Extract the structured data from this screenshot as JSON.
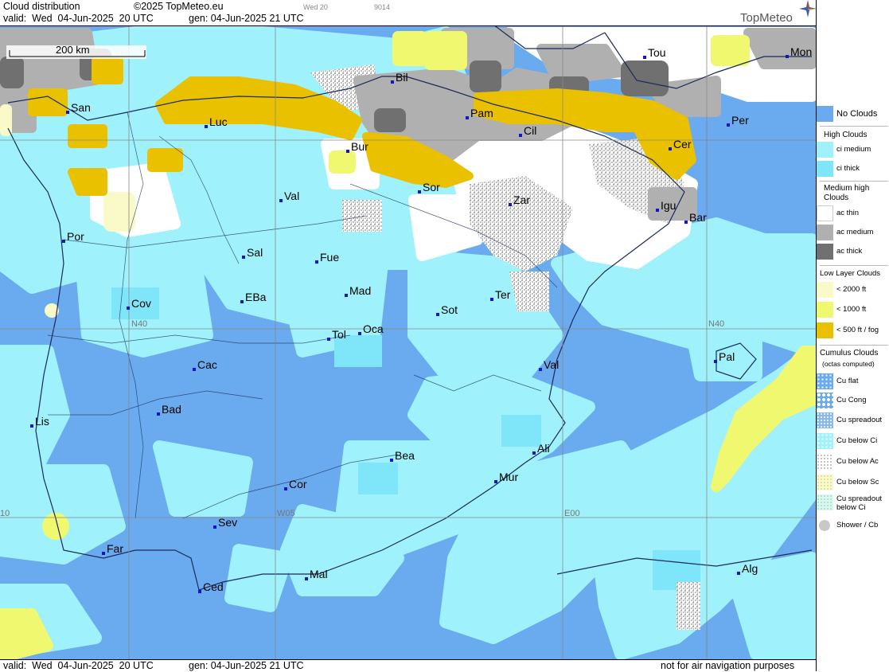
{
  "header": {
    "title": "Cloud distribution",
    "copyright": "©2025 TopMeteo.eu",
    "valid_line": "valid:  Wed  04-Jun-2025  20 UTC",
    "gen_line": "gen: 04-Jun-2025 21 UTC",
    "small_a": "Wed 20",
    "small_b": "9014",
    "logo": "TopMeteo"
  },
  "footer": {
    "valid": "valid:  Wed  04-Jun-2025  20 UTC",
    "gen": "gen: 04-Jun-2025 21 UTC",
    "disclaimer": "not for air navigation purposes"
  },
  "map": {
    "scale_label": "200 km",
    "grid_labels": {
      "n40_left": "N40",
      "n40_right": "N40",
      "w05": "W05",
      "e00": "E00",
      "w10": "10"
    },
    "cities": [
      "San",
      "Bil",
      "Tou",
      "Mon",
      "Luc",
      "Pam",
      "Cil",
      "Per",
      "Bur",
      "Cer",
      "Val",
      "Sor",
      "Zar",
      "Igu",
      "Bar",
      "Por",
      "Sal",
      "Fue",
      "Mad",
      "EBa",
      "Cov",
      "Ter",
      "Sot",
      "Tol",
      "Oca",
      "Pal",
      "Cac",
      "Val",
      "Bad",
      "Lis",
      "Ali",
      "Bea",
      "Mur",
      "Cor",
      "Sev",
      "Far",
      "Alg",
      "Mal",
      "Ced"
    ]
  },
  "legend": {
    "no_clouds": "No Clouds",
    "high_head": "High Clouds",
    "ci_medium": "ci medium",
    "ci_thick": "ci thick",
    "medium_head": "Medium high Clouds",
    "ac_thin": "ac thin",
    "ac_medium": "ac medium",
    "ac_thick": "ac thick",
    "low_head": "Low Layer Clouds",
    "low1": "< 2000 ft",
    "low2": "< 1000 ft",
    "low3": "< 500 ft / fog",
    "cu_head": "Cumulus Clouds",
    "cu_sub": "(octas computed)",
    "cu_flat": "Cu flat",
    "cu_cong": "Cu Cong",
    "cu_spread": "Cu spreadout",
    "cu_below_ci": "Cu below Ci",
    "cu_below_ac": "Cu below Ac",
    "cu_below_sc": "Cu below Sc",
    "cu_spread_ci": "Cu spreadout below Ci",
    "shower": "Shower / Cb"
  },
  "colors": {
    "no_clouds": "#6aaaee",
    "ci_medium": "#9ff2fb",
    "ci_thick": "#7ee6f8",
    "ac_thin": "#ffffff",
    "ac_medium": "#b0b0b0",
    "ac_thick": "#707070",
    "low_2000": "#fafac8",
    "low_1000": "#f0f870",
    "low_500": "#e9c100"
  }
}
